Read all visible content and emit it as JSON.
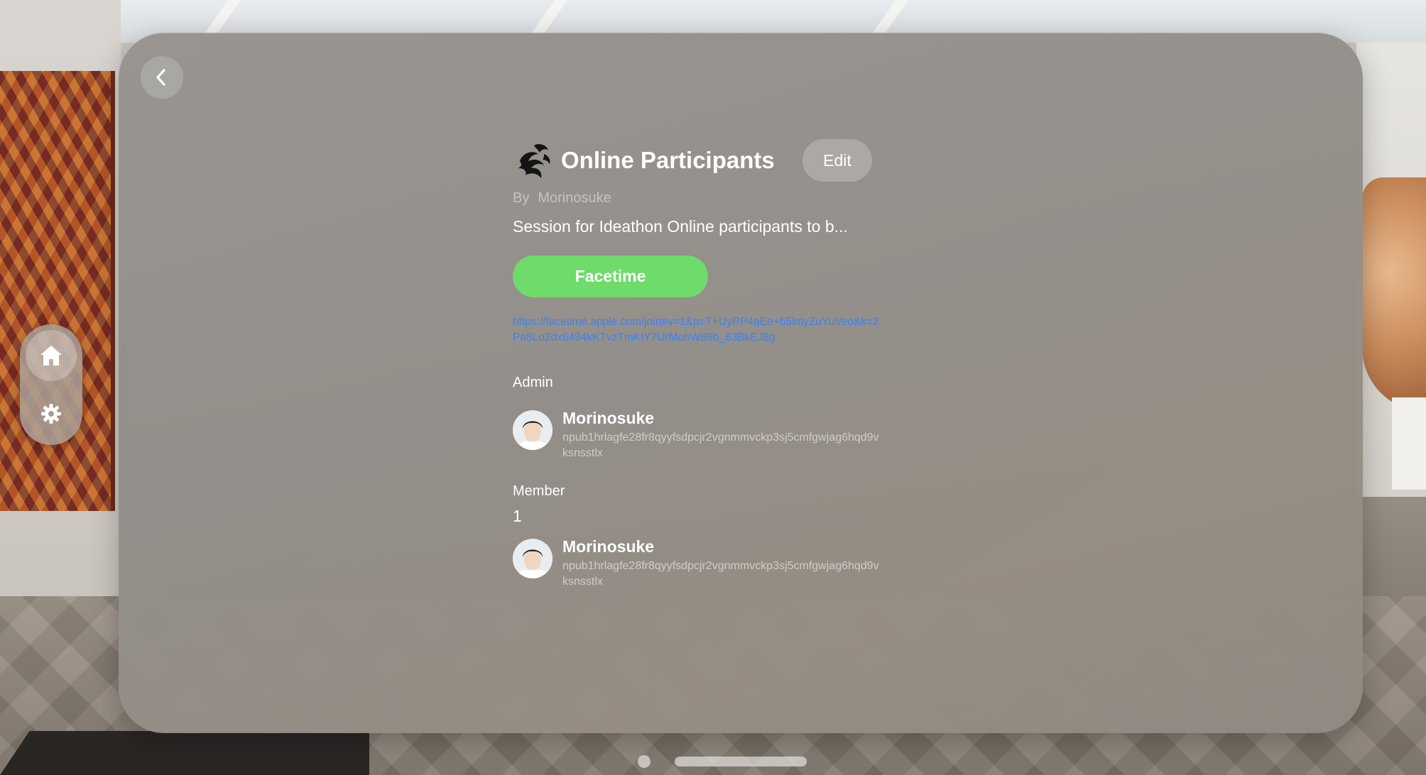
{
  "header": {
    "title": "Online Participants",
    "edit_label": "Edit"
  },
  "byline": {
    "prefix": "By",
    "author": "Morinosuke"
  },
  "description": "Session for Ideathon Online participants to b...",
  "facetime": {
    "button_label": "Facetime",
    "link": "https://facetime.apple.com/join#v=1&p=T+UyRP4aEe+b5lmyZuYuVeo&k=2Pa8Lo2dx6494kKTvzTmKIY7UrMohW86b_63BkEJ8g"
  },
  "admin": {
    "section_label": "Admin",
    "people": [
      {
        "name": "Morinosuke",
        "key": "npub1hrlagfe28fr8qyyfsdpcjr2vgnmmvckp3sj5cmfgwjag6hqd9vksnsstlx"
      }
    ]
  },
  "member": {
    "section_label": "Member",
    "count": "1",
    "people": [
      {
        "name": "Morinosuke",
        "key": "npub1hrlagfe28fr8qyyfsdpcjr2vgnmmvckp3sj5cmfgwjag6hqd9vksnsstlx"
      }
    ]
  },
  "ornament": {
    "items": [
      {
        "icon": "home-icon"
      },
      {
        "icon": "gear-icon"
      }
    ]
  },
  "icons": {
    "back": "chevron-left-icon",
    "logo": "community-logo-icon",
    "avatar": "avatar-photo"
  },
  "colors": {
    "facetime_green": "#6edb6a",
    "link_blue": "#3b82f6",
    "window_glass": "#96938f"
  }
}
